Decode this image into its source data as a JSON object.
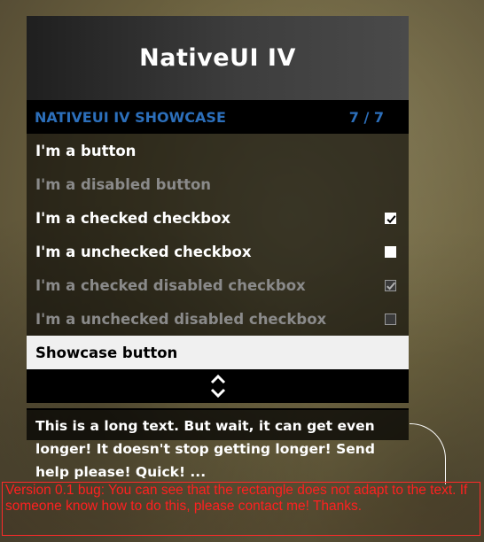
{
  "menu": {
    "title": "NativeUI IV",
    "subtitle": "NATIVEUI IV SHOWCASE",
    "counter": "7 / 7",
    "items": [
      {
        "label": "I'm a button",
        "type": "button",
        "enabled": true
      },
      {
        "label": "I'm a disabled button",
        "type": "button",
        "enabled": false
      },
      {
        "label": "I'm a checked checkbox",
        "type": "checkbox",
        "checked": true,
        "enabled": true
      },
      {
        "label": "I'm a unchecked checkbox",
        "type": "checkbox",
        "checked": false,
        "enabled": true
      },
      {
        "label": "I'm a checked disabled checkbox",
        "type": "checkbox",
        "checked": true,
        "enabled": false
      },
      {
        "label": "I'm a unchecked disabled checkbox",
        "type": "checkbox",
        "checked": false,
        "enabled": false
      },
      {
        "label": "Showcase button",
        "type": "button",
        "enabled": true,
        "selected": true
      }
    ],
    "navigation_icon": "up-down-chevron-icon",
    "description": "This is a long text. But wait, it can get even longer! It doesn't stop getting longer! Send help please! Quick! ..."
  },
  "bug_note": {
    "text": "Version 0.1 bug: You can see that the rectangle does not adapt to the text. If someone know how to do this, please contact me! Thanks."
  },
  "colors": {
    "subtitle_text": "#2c6fbb",
    "bug_text": "#ff2020",
    "selected_item_bg": "#f0f0f0"
  }
}
